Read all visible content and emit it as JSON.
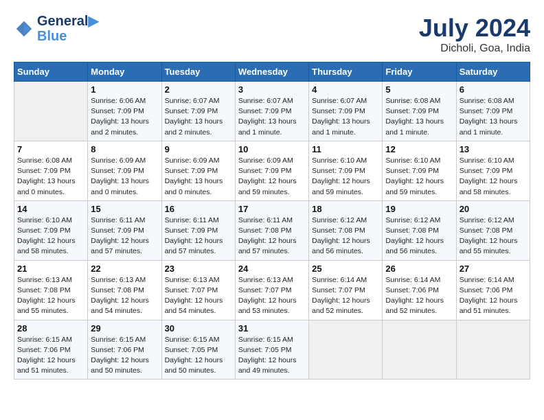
{
  "header": {
    "logo_line1": "General",
    "logo_line2": "Blue",
    "month_year": "July 2024",
    "location": "Dicholi, Goa, India"
  },
  "days_of_week": [
    "Sunday",
    "Monday",
    "Tuesday",
    "Wednesday",
    "Thursday",
    "Friday",
    "Saturday"
  ],
  "weeks": [
    [
      {
        "day": "",
        "sunrise": "",
        "sunset": "",
        "daylight": ""
      },
      {
        "day": "1",
        "sunrise": "Sunrise: 6:06 AM",
        "sunset": "Sunset: 7:09 PM",
        "daylight": "Daylight: 13 hours and 2 minutes."
      },
      {
        "day": "2",
        "sunrise": "Sunrise: 6:07 AM",
        "sunset": "Sunset: 7:09 PM",
        "daylight": "Daylight: 13 hours and 2 minutes."
      },
      {
        "day": "3",
        "sunrise": "Sunrise: 6:07 AM",
        "sunset": "Sunset: 7:09 PM",
        "daylight": "Daylight: 13 hours and 1 minute."
      },
      {
        "day": "4",
        "sunrise": "Sunrise: 6:07 AM",
        "sunset": "Sunset: 7:09 PM",
        "daylight": "Daylight: 13 hours and 1 minute."
      },
      {
        "day": "5",
        "sunrise": "Sunrise: 6:08 AM",
        "sunset": "Sunset: 7:09 PM",
        "daylight": "Daylight: 13 hours and 1 minute."
      },
      {
        "day": "6",
        "sunrise": "Sunrise: 6:08 AM",
        "sunset": "Sunset: 7:09 PM",
        "daylight": "Daylight: 13 hours and 1 minute."
      }
    ],
    [
      {
        "day": "7",
        "sunrise": "Sunrise: 6:08 AM",
        "sunset": "Sunset: 7:09 PM",
        "daylight": "Daylight: 13 hours and 0 minutes."
      },
      {
        "day": "8",
        "sunrise": "Sunrise: 6:09 AM",
        "sunset": "Sunset: 7:09 PM",
        "daylight": "Daylight: 13 hours and 0 minutes."
      },
      {
        "day": "9",
        "sunrise": "Sunrise: 6:09 AM",
        "sunset": "Sunset: 7:09 PM",
        "daylight": "Daylight: 13 hours and 0 minutes."
      },
      {
        "day": "10",
        "sunrise": "Sunrise: 6:09 AM",
        "sunset": "Sunset: 7:09 PM",
        "daylight": "Daylight: 12 hours and 59 minutes."
      },
      {
        "day": "11",
        "sunrise": "Sunrise: 6:10 AM",
        "sunset": "Sunset: 7:09 PM",
        "daylight": "Daylight: 12 hours and 59 minutes."
      },
      {
        "day": "12",
        "sunrise": "Sunrise: 6:10 AM",
        "sunset": "Sunset: 7:09 PM",
        "daylight": "Daylight: 12 hours and 59 minutes."
      },
      {
        "day": "13",
        "sunrise": "Sunrise: 6:10 AM",
        "sunset": "Sunset: 7:09 PM",
        "daylight": "Daylight: 12 hours and 58 minutes."
      }
    ],
    [
      {
        "day": "14",
        "sunrise": "Sunrise: 6:10 AM",
        "sunset": "Sunset: 7:09 PM",
        "daylight": "Daylight: 12 hours and 58 minutes."
      },
      {
        "day": "15",
        "sunrise": "Sunrise: 6:11 AM",
        "sunset": "Sunset: 7:09 PM",
        "daylight": "Daylight: 12 hours and 57 minutes."
      },
      {
        "day": "16",
        "sunrise": "Sunrise: 6:11 AM",
        "sunset": "Sunset: 7:09 PM",
        "daylight": "Daylight: 12 hours and 57 minutes."
      },
      {
        "day": "17",
        "sunrise": "Sunrise: 6:11 AM",
        "sunset": "Sunset: 7:08 PM",
        "daylight": "Daylight: 12 hours and 57 minutes."
      },
      {
        "day": "18",
        "sunrise": "Sunrise: 6:12 AM",
        "sunset": "Sunset: 7:08 PM",
        "daylight": "Daylight: 12 hours and 56 minutes."
      },
      {
        "day": "19",
        "sunrise": "Sunrise: 6:12 AM",
        "sunset": "Sunset: 7:08 PM",
        "daylight": "Daylight: 12 hours and 56 minutes."
      },
      {
        "day": "20",
        "sunrise": "Sunrise: 6:12 AM",
        "sunset": "Sunset: 7:08 PM",
        "daylight": "Daylight: 12 hours and 55 minutes."
      }
    ],
    [
      {
        "day": "21",
        "sunrise": "Sunrise: 6:13 AM",
        "sunset": "Sunset: 7:08 PM",
        "daylight": "Daylight: 12 hours and 55 minutes."
      },
      {
        "day": "22",
        "sunrise": "Sunrise: 6:13 AM",
        "sunset": "Sunset: 7:08 PM",
        "daylight": "Daylight: 12 hours and 54 minutes."
      },
      {
        "day": "23",
        "sunrise": "Sunrise: 6:13 AM",
        "sunset": "Sunset: 7:07 PM",
        "daylight": "Daylight: 12 hours and 54 minutes."
      },
      {
        "day": "24",
        "sunrise": "Sunrise: 6:13 AM",
        "sunset": "Sunset: 7:07 PM",
        "daylight": "Daylight: 12 hours and 53 minutes."
      },
      {
        "day": "25",
        "sunrise": "Sunrise: 6:14 AM",
        "sunset": "Sunset: 7:07 PM",
        "daylight": "Daylight: 12 hours and 52 minutes."
      },
      {
        "day": "26",
        "sunrise": "Sunrise: 6:14 AM",
        "sunset": "Sunset: 7:06 PM",
        "daylight": "Daylight: 12 hours and 52 minutes."
      },
      {
        "day": "27",
        "sunrise": "Sunrise: 6:14 AM",
        "sunset": "Sunset: 7:06 PM",
        "daylight": "Daylight: 12 hours and 51 minutes."
      }
    ],
    [
      {
        "day": "28",
        "sunrise": "Sunrise: 6:15 AM",
        "sunset": "Sunset: 7:06 PM",
        "daylight": "Daylight: 12 hours and 51 minutes."
      },
      {
        "day": "29",
        "sunrise": "Sunrise: 6:15 AM",
        "sunset": "Sunset: 7:06 PM",
        "daylight": "Daylight: 12 hours and 50 minutes."
      },
      {
        "day": "30",
        "sunrise": "Sunrise: 6:15 AM",
        "sunset": "Sunset: 7:05 PM",
        "daylight": "Daylight: 12 hours and 50 minutes."
      },
      {
        "day": "31",
        "sunrise": "Sunrise: 6:15 AM",
        "sunset": "Sunset: 7:05 PM",
        "daylight": "Daylight: 12 hours and 49 minutes."
      },
      {
        "day": "",
        "sunrise": "",
        "sunset": "",
        "daylight": ""
      },
      {
        "day": "",
        "sunrise": "",
        "sunset": "",
        "daylight": ""
      },
      {
        "day": "",
        "sunrise": "",
        "sunset": "",
        "daylight": ""
      }
    ]
  ]
}
